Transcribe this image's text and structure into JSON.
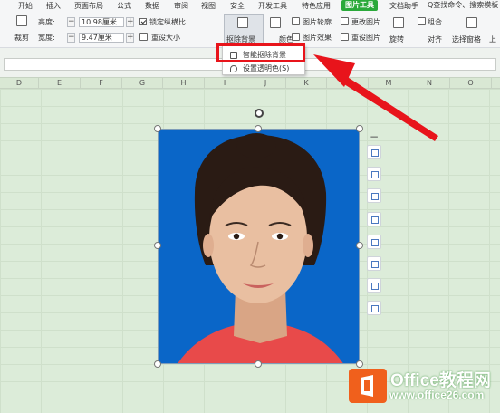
{
  "menu": {
    "items": [
      "开始",
      "插入",
      "页面布局",
      "公式",
      "数据",
      "审阅",
      "视图",
      "安全",
      "开发工具",
      "特色应用",
      "图片工具",
      "文档助手"
    ],
    "active": "图片工具",
    "search": "Q查找命令、搜索模板"
  },
  "ribbon": {
    "crop_label": "裁剪",
    "height_label": "高度:",
    "height_value": "10.98厘米",
    "width_label": "宽度:",
    "width_value": "9.47厘米",
    "lock_ratio_label": "锁定纵横比",
    "reset_size_label": "重设大小",
    "remove_bg_label": "抠除背景",
    "color_label": "颜色",
    "picture_outline_label": "图片轮廓",
    "picture_effect_label": "图片效果",
    "change_picture_label": "更改图片",
    "reset_picture_label": "重设图片",
    "rotate_label": "旋转",
    "combine_label": "组合",
    "align_label": "对齐",
    "selection_pane_label": "选择窗格",
    "more_label": "上"
  },
  "dropdown": {
    "items": [
      "智能抠除背景",
      "设置透明色(S)"
    ]
  },
  "columns": [
    "D",
    "E",
    "F",
    "G",
    "H",
    "I",
    "J",
    "K",
    "L",
    "M",
    "N",
    "O"
  ],
  "watermark": {
    "title": "Office教程网",
    "url": "www.office26.com"
  },
  "colors": {
    "accent_green": "#2aa93a",
    "photo_background": "#0a66c8",
    "highlight_red": "#e8141b",
    "sheet_green": "#dcecd9"
  }
}
